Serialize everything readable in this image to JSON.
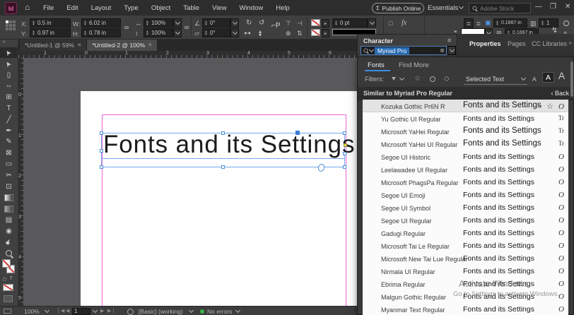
{
  "menubar": {
    "logo": "Id",
    "menus": [
      {
        "label": "File"
      },
      {
        "label": "Edit"
      },
      {
        "label": "Layout"
      },
      {
        "label": "Type"
      },
      {
        "label": "Object"
      },
      {
        "label": "Table"
      },
      {
        "label": "View"
      },
      {
        "label": "Window"
      },
      {
        "label": "Help"
      }
    ],
    "publish_label": "Publish Online",
    "workspace": "Essentials",
    "stock_placeholder": "Adobe Stock"
  },
  "controlbar": {
    "x_label": "X:",
    "x_value": "0.5 in",
    "y_label": "Y:",
    "y_value": "0.97 in",
    "w_label": "W:",
    "w_value": "6.02 in",
    "h_label": "H:",
    "h_value": "0.78 in",
    "scale_x": "100%",
    "scale_y": "100%",
    "rotation": "0°",
    "shear": "0°",
    "stroke_weight": "0 pt",
    "fx_label": "fx",
    "inset_value": "0.1667 in",
    "columns_value": "1",
    "gutter_value": "0.1667 in"
  },
  "doc_tabs": [
    {
      "label": "*Untitled-1 @ 59%",
      "active": false
    },
    {
      "label": "*Untitled-2 @ 100%",
      "active": true
    }
  ],
  "tools": [
    {
      "name": "selection-tool",
      "glyph": "➤",
      "rot": -125,
      "selected": true
    },
    {
      "name": "direct-selection-tool",
      "glyph": "➤",
      "rot": -125
    },
    {
      "name": "page-tool",
      "glyph": "▯"
    },
    {
      "name": "gap-tool",
      "glyph": "⇔"
    },
    {
      "name": "content-collector-tool",
      "glyph": "⊞"
    },
    {
      "name": "type-tool",
      "glyph": "T"
    },
    {
      "name": "line-tool",
      "glyph": "╱"
    },
    {
      "name": "pen-tool",
      "glyph": "✒"
    },
    {
      "name": "pencil-tool",
      "glyph": "✎"
    },
    {
      "name": "rectangle-frame-tool",
      "glyph": "⊠"
    },
    {
      "name": "rectangle-tool",
      "glyph": "▭"
    },
    {
      "name": "scissors-tool",
      "glyph": "✂"
    },
    {
      "name": "free-transform-tool",
      "glyph": "⊡"
    },
    {
      "name": "gradient-swatch-tool",
      "css": "grad-sw"
    },
    {
      "name": "gradient-feather-tool",
      "css": "gradf-sw"
    },
    {
      "name": "note-tool",
      "glyph": "▤"
    },
    {
      "name": "color-theme-tool",
      "glyph": "◉"
    },
    {
      "name": "hand-tool",
      "glyph": "☛",
      "rot": -45
    },
    {
      "name": "zoom-tool",
      "css": "mag"
    }
  ],
  "ruler": {
    "h_numbers": [
      "1",
      "0",
      "1",
      "2",
      "3",
      "4",
      "5",
      "6"
    ],
    "v_numbers": [
      "0",
      "1",
      "2",
      "3",
      "4",
      "5"
    ]
  },
  "canvas": {
    "frame_text": "Fonts and its Settings"
  },
  "character_panel": {
    "title": "Character",
    "search_value": "Myriad Pro",
    "tab_fonts": "Fonts",
    "tab_findmore": "Find More",
    "filters_label": "Filters:",
    "selection_scope": "Selected Text",
    "similar_header": "Similar to Myriad Pro Regular",
    "back_label": "Back",
    "preview_text": "Fonts and its Settings"
  },
  "dock_tabs": [
    {
      "label": "Properties",
      "active": true
    },
    {
      "label": "Pages",
      "active": false
    },
    {
      "label": "CC Libraries",
      "active": false
    }
  ],
  "font_list": [
    {
      "name": "Kozuka Gothic Pr6N R",
      "icons": [
        "similar",
        "favorite",
        "opentype"
      ],
      "highlighted": true,
      "big": true
    },
    {
      "name": "Yu Gothic UI Regular",
      "icons": [
        "truetype"
      ]
    },
    {
      "name": "Microsoft YaHei Regular",
      "icons": [
        "truetype"
      ],
      "big": true
    },
    {
      "name": "Microsoft YaHei UI Regular",
      "icons": [
        "truetype"
      ],
      "big": true
    },
    {
      "name": "Segoe UI Historic",
      "icons": [
        "opentype"
      ]
    },
    {
      "name": "Leelawadee UI Regular",
      "icons": [
        "opentype"
      ]
    },
    {
      "name": "Microsoft PhagsPa Regular",
      "icons": [
        "opentype"
      ]
    },
    {
      "name": "Segoe UI Emoji",
      "icons": [
        "opentype"
      ]
    },
    {
      "name": "Segoe UI Symbol",
      "icons": [
        "opentype"
      ]
    },
    {
      "name": "Segoe UI Regular",
      "icons": [
        "opentype"
      ]
    },
    {
      "name": "Gadugi Regular",
      "icons": [
        "opentype"
      ]
    },
    {
      "name": "Microsoft Tai Le Regular",
      "icons": [
        "opentype"
      ]
    },
    {
      "name": "Microsoft New Tai Lue Regular",
      "icons": [
        "opentype"
      ]
    },
    {
      "name": "Nirmala UI Regular",
      "icons": [
        "opentype"
      ]
    },
    {
      "name": "Ebrima Regular",
      "icons": [
        "opentype"
      ]
    },
    {
      "name": "Malgun Gothic Regular",
      "icons": [
        "opentype"
      ]
    },
    {
      "name": "Myanmar Text Regular",
      "icons": [
        "opentype"
      ]
    }
  ],
  "statusbar": {
    "zoom": "100%",
    "page": "1",
    "profile": "[Basic] (working)",
    "errors": "No errors"
  },
  "watermark": {
    "line1": "Activate Windows",
    "line2": "Go to Settings to activate Windows."
  }
}
